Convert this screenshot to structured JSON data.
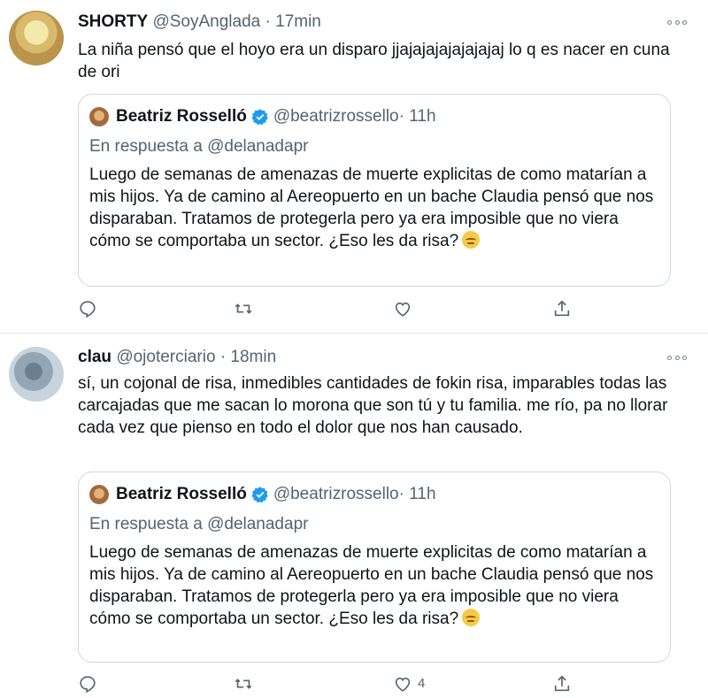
{
  "tweets": [
    {
      "name": "SHORTY",
      "handle": "@SoyAnglada",
      "time": "· 17min",
      "text": "La niña pensó que el hoyo era un disparo jjajajajajajajajaj lo q es nacer en cuna de ori",
      "quote": {
        "name": "Beatriz Rosselló",
        "handle": "@beatrizrossello",
        "time": "· 11h",
        "reply_prefix": "En respuesta a",
        "reply_handle": "@delanadapr",
        "text": "Luego de semanas de amenazas de muerte explicitas de como matarían a mis hijos. Ya de camino al Aereopuerto en un bache Claudia pensó que nos disparaban. Tratamos de protegerla pero ya era imposible que no viera cómo se comportaba un sector.  ¿Eso les da risa?",
        "emoji": "relieved-face-icon"
      },
      "actions": {
        "like_count": ""
      }
    },
    {
      "name": "clau",
      "handle": "@ojoterciario",
      "time": "· 18min",
      "text": "sí, un cojonal de risa, inmedibles cantidades de fokin risa, imparables todas las carcajadas que me sacan lo morona que son tú y tu familia. me río, pa no llorar cada vez que pienso en todo el dolor que nos han causado.",
      "quote": {
        "name": "Beatriz Rosselló",
        "handle": "@beatrizrossello",
        "time": "· 11h",
        "reply_prefix": "En respuesta a",
        "reply_handle": "@delanadapr",
        "text": "Luego de semanas de amenazas de muerte explicitas de como matarían a mis hijos. Ya de camino al Aereopuerto en un bache Claudia pensó que nos disparaban. Tratamos de protegerla pero ya era imposible que no viera cómo se comportaba un sector.  ¿Eso les da risa?",
        "emoji": "relieved-face-icon"
      },
      "actions": {
        "like_count": "4"
      }
    }
  ],
  "colors": {
    "text": "#0f1419",
    "muted": "#536471",
    "verified": "#1d9bf0",
    "border": "#cfd9de"
  }
}
